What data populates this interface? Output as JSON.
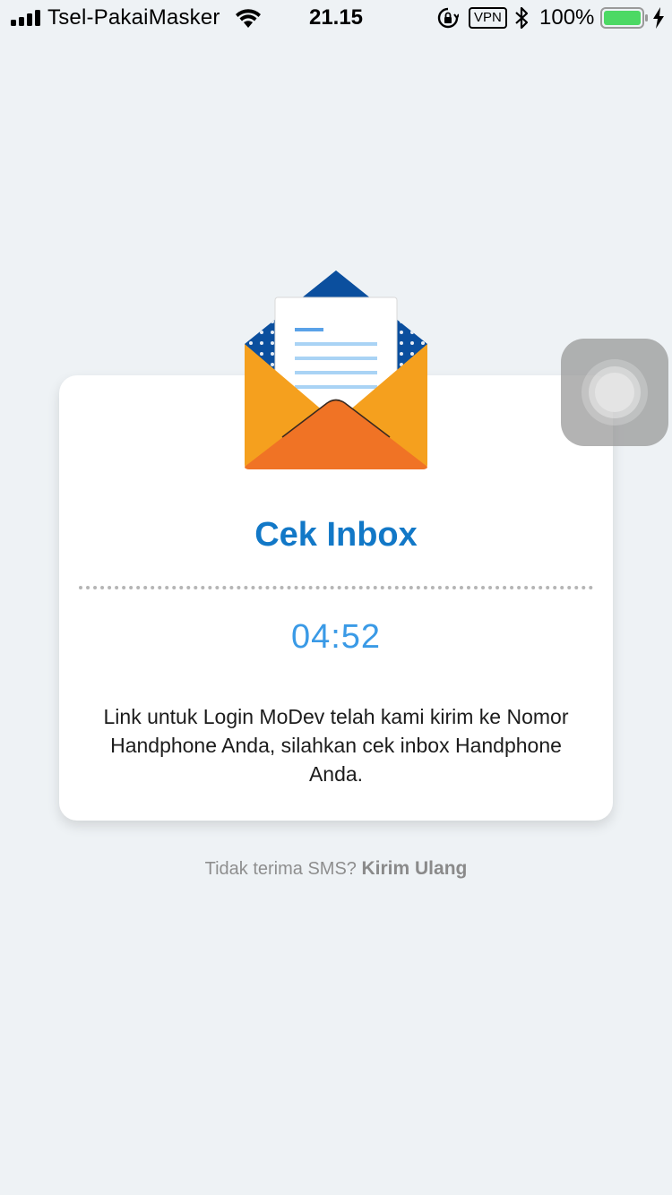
{
  "status_bar": {
    "carrier": "Tsel-PakaiMasker",
    "time": "21.15",
    "vpn_label": "VPN",
    "battery_percent": "100%",
    "battery_level": 1.0,
    "battery_color": "#4cd964",
    "icons": [
      "signal-icon",
      "wifi-icon",
      "orientation-lock-icon",
      "bluetooth-icon",
      "battery-icon",
      "charging-icon"
    ]
  },
  "card": {
    "illustration": "open-envelope-icon",
    "title": "Cek Inbox",
    "timer": "04:52",
    "message": "Link untuk Login MoDev telah kami kirim ke Nomor Handphone Anda, silahkan cek inbox Handphone Anda."
  },
  "resend": {
    "prompt": "Tidak terima SMS?",
    "link": "Kirim Ulang"
  },
  "colors": {
    "background": "#eef2f5",
    "title": "#1278c7",
    "timer": "#3a9ae6",
    "envelope_blue": "#0b4f9e",
    "envelope_orange": "#f5a01e",
    "envelope_dark_orange": "#f07325"
  }
}
